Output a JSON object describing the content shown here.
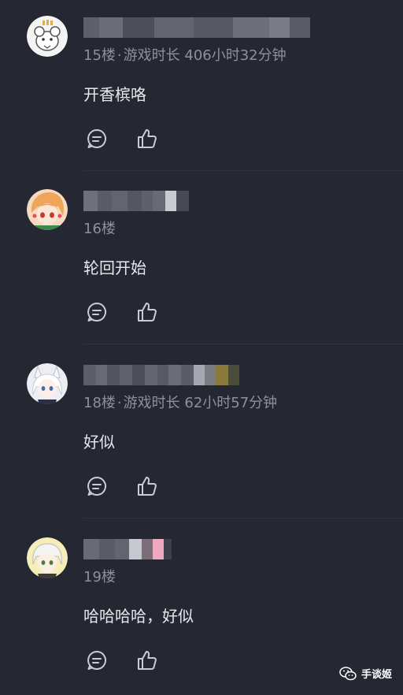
{
  "comments": [
    {
      "floor_meta": "15楼",
      "playtime": "游戏时长 406小时32分钟",
      "content": "开香槟咯",
      "avatar_icon": "rat-avatar-icon"
    },
    {
      "floor_meta": "16楼",
      "playtime": "",
      "content": "轮回开始",
      "avatar_icon": "anime-girl-avatar-icon"
    },
    {
      "floor_meta": "18楼",
      "playtime": "游戏时长 62小时57分钟",
      "content": "好似",
      "avatar_icon": "fox-girl-avatar-icon"
    },
    {
      "floor_meta": "19楼",
      "playtime": "",
      "content": "哈哈哈哈，好似",
      "avatar_icon": "white-hair-boy-avatar-icon"
    }
  ],
  "separator": "·",
  "watermark": {
    "label": "手谈姬",
    "icon": "wechat-icon"
  },
  "colors": {
    "background": "#252832",
    "text_primary": "#e7e8ec",
    "text_secondary": "#8d909a",
    "icon": "#c9ccd3"
  }
}
